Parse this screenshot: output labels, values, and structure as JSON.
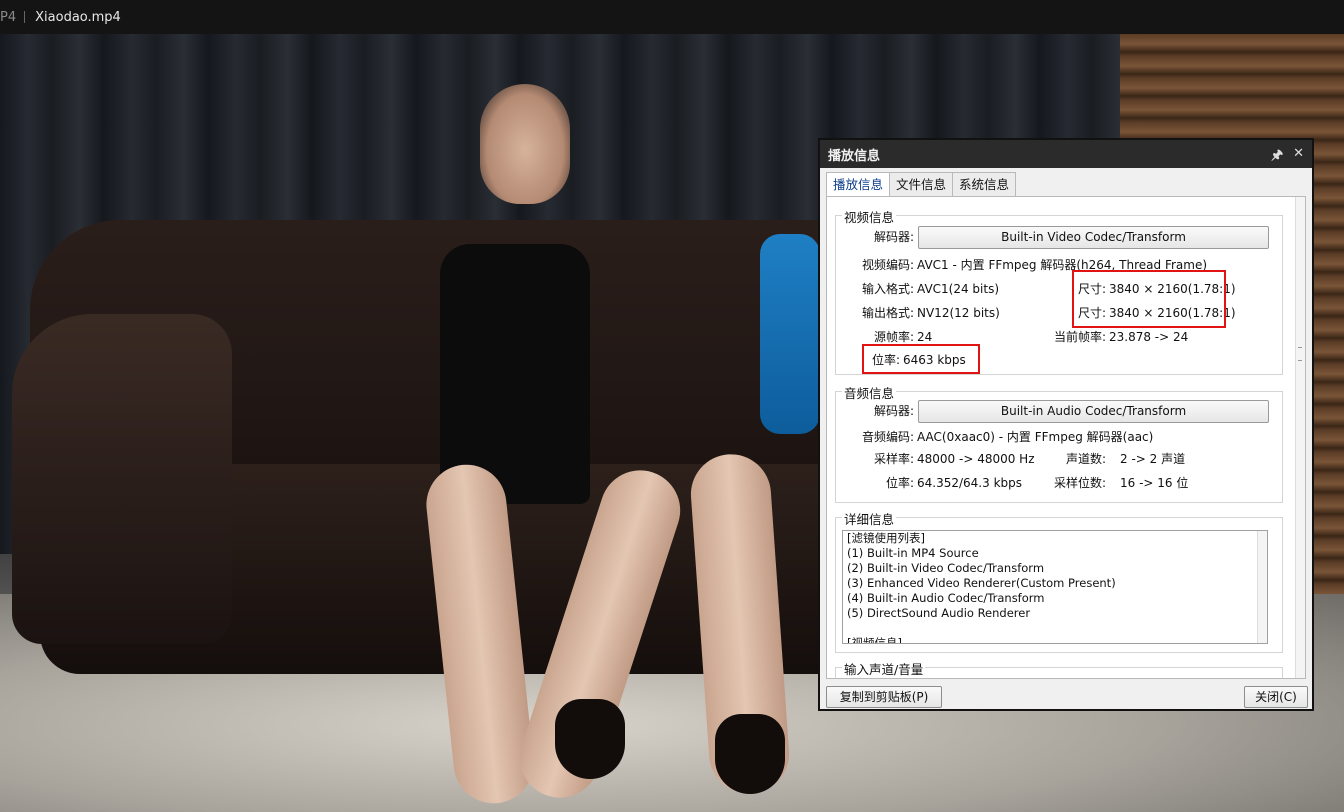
{
  "window": {
    "format_label": "P4",
    "file_name": "Xiaodao.mp4"
  },
  "dialog": {
    "title": "播放信息",
    "pin_icon": "pin-icon",
    "close_icon": "close-icon",
    "tabs": [
      "播放信息",
      "文件信息",
      "系统信息"
    ],
    "video": {
      "section": "视频信息",
      "decoder_label": "解码器:",
      "decoder_value": "Built-in Video Codec/Transform",
      "codec_label": "视频编码:",
      "codec_value": "AVC1 - 内置 FFmpeg 解码器(h264, Thread Frame)",
      "input_label": "输入格式:",
      "input_value": "AVC1(24 bits)",
      "input_size_label": "尺寸:",
      "input_size_value": "3840 × 2160(1.78:1)",
      "output_label": "输出格式:",
      "output_value": "NV12(12 bits)",
      "output_size_label": "尺寸:",
      "output_size_value": "3840 × 2160(1.78:1)",
      "src_fps_label": "源帧率:",
      "src_fps_value": "24",
      "cur_fps_label": "当前帧率:",
      "cur_fps_value": "23.878 -> 24",
      "bitrate_label": "位率:",
      "bitrate_value": "6463 kbps"
    },
    "audio": {
      "section": "音频信息",
      "decoder_label": "解码器:",
      "decoder_value": "Built-in Audio Codec/Transform",
      "codec_label": "音频编码:",
      "codec_value": "AAC(0xaac0) - 内置 FFmpeg 解码器(aac)",
      "rate_label": "采样率:",
      "rate_value": "48000 -> 48000 Hz",
      "channels_label": "声道数:",
      "channels_value": "2 -> 2 声道",
      "bitrate_label": "位率:",
      "bitrate_value": "64.352/64.3 kbps",
      "bits_label": "采样位数:",
      "bits_value": "16 -> 16 位"
    },
    "details": {
      "section": "详细信息",
      "lines": [
        "[滤镜使用列表]",
        " (1) Built-in MP4 Source",
        " (2) Built-in Video Codec/Transform",
        " (3) Enhanced Video Renderer(Custom Present)",
        " (4) Built-in Audio Codec/Transform",
        " (5) DirectSound Audio Renderer",
        "",
        "[视频信息]"
      ]
    },
    "input_channel_section": "输入声道/音量",
    "copy_button": "复制到剪贴板(P)",
    "close_button": "关闭(C)"
  },
  "colors": {
    "highlight_box": "#e01414",
    "title_bar": "#2b2b2b",
    "active_tab_text": "#0b3e8a"
  }
}
